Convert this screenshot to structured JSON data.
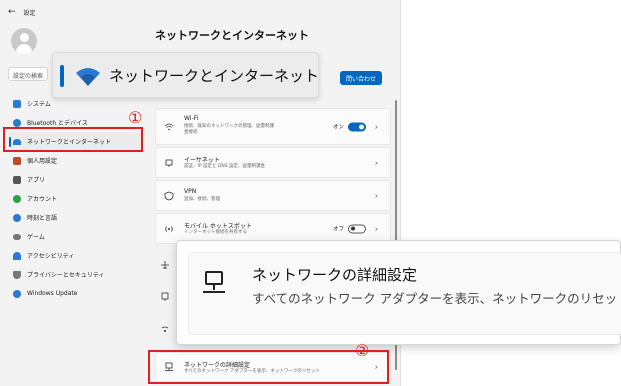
{
  "titlebar": {
    "back_icon": "back-arrow-icon",
    "title": "設定"
  },
  "search": {
    "placeholder": "設定の検索"
  },
  "sidebar": {
    "items": [
      {
        "label": "システム",
        "icon": "system-icon",
        "color": "#2b79d0"
      },
      {
        "label": "Bluetooth とデバイス",
        "icon": "bluetooth-icon",
        "color": "#2b79d0"
      },
      {
        "label": "ネットワークとインターネット",
        "icon": "wifi-icon",
        "color": "#2b79d0"
      },
      {
        "label": "個人用設定",
        "icon": "brush-icon",
        "color": "#c14a2d"
      },
      {
        "label": "アプリ",
        "icon": "apps-icon",
        "color": "#555555"
      },
      {
        "label": "アカウント",
        "icon": "person-icon",
        "color": "#2ea043"
      },
      {
        "label": "時刻と言語",
        "icon": "globe-icon",
        "color": "#2b79d0"
      },
      {
        "label": "ゲーム",
        "icon": "gamepad-icon",
        "color": "#777777"
      },
      {
        "label": "アクセシビリティ",
        "icon": "accessibility-icon",
        "color": "#2b79d0"
      },
      {
        "label": "プライバシーとセキュリティ",
        "icon": "shield-icon",
        "color": "#777777"
      },
      {
        "label": "Windows Update",
        "icon": "update-icon",
        "color": "#2b79d0"
      }
    ],
    "selected_index": 2
  },
  "page": {
    "title": "ネットワークとインターネット",
    "contact_button": "問い合わせ"
  },
  "zoom_callout_1": {
    "label": "ネットワークとインターネット"
  },
  "cards": {
    "wifi": {
      "title": "Wi-Fi",
      "sub1": "接続、既知のネットワークの管理、従量制課",
      "sub2": "金接続",
      "toggle_label": "オン",
      "toggle_on": true
    },
    "ethernet": {
      "title": "イーサネット",
      "sub1": "認証、IP 設定と DNS 設定、従量制課金"
    },
    "vpn": {
      "title": "VPN",
      "sub1": "追加、接続、管理"
    },
    "mobile": {
      "title": "モバイル ホットスポット",
      "sub1": "インターネット接続を共有する",
      "toggle_label": "オフ",
      "toggle_on": false
    },
    "advanced": {
      "title": "ネットワークの詳細設定",
      "sub1": "すべてのネットワーク アダプターを表示、ネットワークのリセット"
    }
  },
  "zoom_callout_2": {
    "title": "ネットワークの詳細設定",
    "sub": "すべてのネットワーク アダプターを表示、ネットワークのリセット"
  },
  "annotations": {
    "num1": "①",
    "num2": "②"
  },
  "colors": {
    "accent": "#0067c0",
    "callout": "#e02020"
  }
}
